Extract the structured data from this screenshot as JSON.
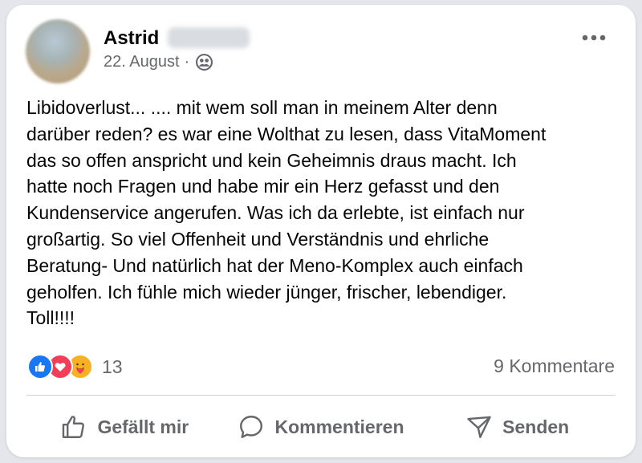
{
  "post": {
    "author": {
      "first_name": "Astrid",
      "last_name_obscured": "Wausern"
    },
    "date": "22. August",
    "separator": "·",
    "audience_icon": "friends-icon",
    "more_icon": "more-options-icon",
    "text": "Libidoverlust... .... mit wem soll man in meinem Alter denn\ndarüber reden? es war eine Wolthat zu lesen, dass VitaMoment\ndas so offen anspricht und kein Geheimnis draus macht. Ich\nhatte noch Fragen und habe mir ein Herz gefasst und den\nKundenservice angerufen. Was ich da erlebte, ist einfach nur\ngroßartig. So viel Offenheit und Verständnis und ehrliche\nBeratung- Und natürlich hat der Meno-Komplex auch einfach\ngeholfen. Ich fühle mich wieder jünger, frischer, lebendiger.\nToll!!!!"
  },
  "reactions": {
    "types": [
      "like",
      "love",
      "care"
    ],
    "count": "13"
  },
  "comments": {
    "label": "9 Kommentare"
  },
  "actions": {
    "like": {
      "label": "Gefällt mir",
      "icon": "thumbs-up-icon"
    },
    "comment": {
      "label": "Kommentieren",
      "icon": "comment-icon"
    },
    "share": {
      "label": "Senden",
      "icon": "send-icon"
    }
  },
  "colors": {
    "text_primary": "#050505",
    "text_secondary": "#65676b",
    "like_blue": "#1877f2",
    "love_red": "#f33e58",
    "care_yellow": "#f7b125",
    "divider": "#ced0d4"
  }
}
